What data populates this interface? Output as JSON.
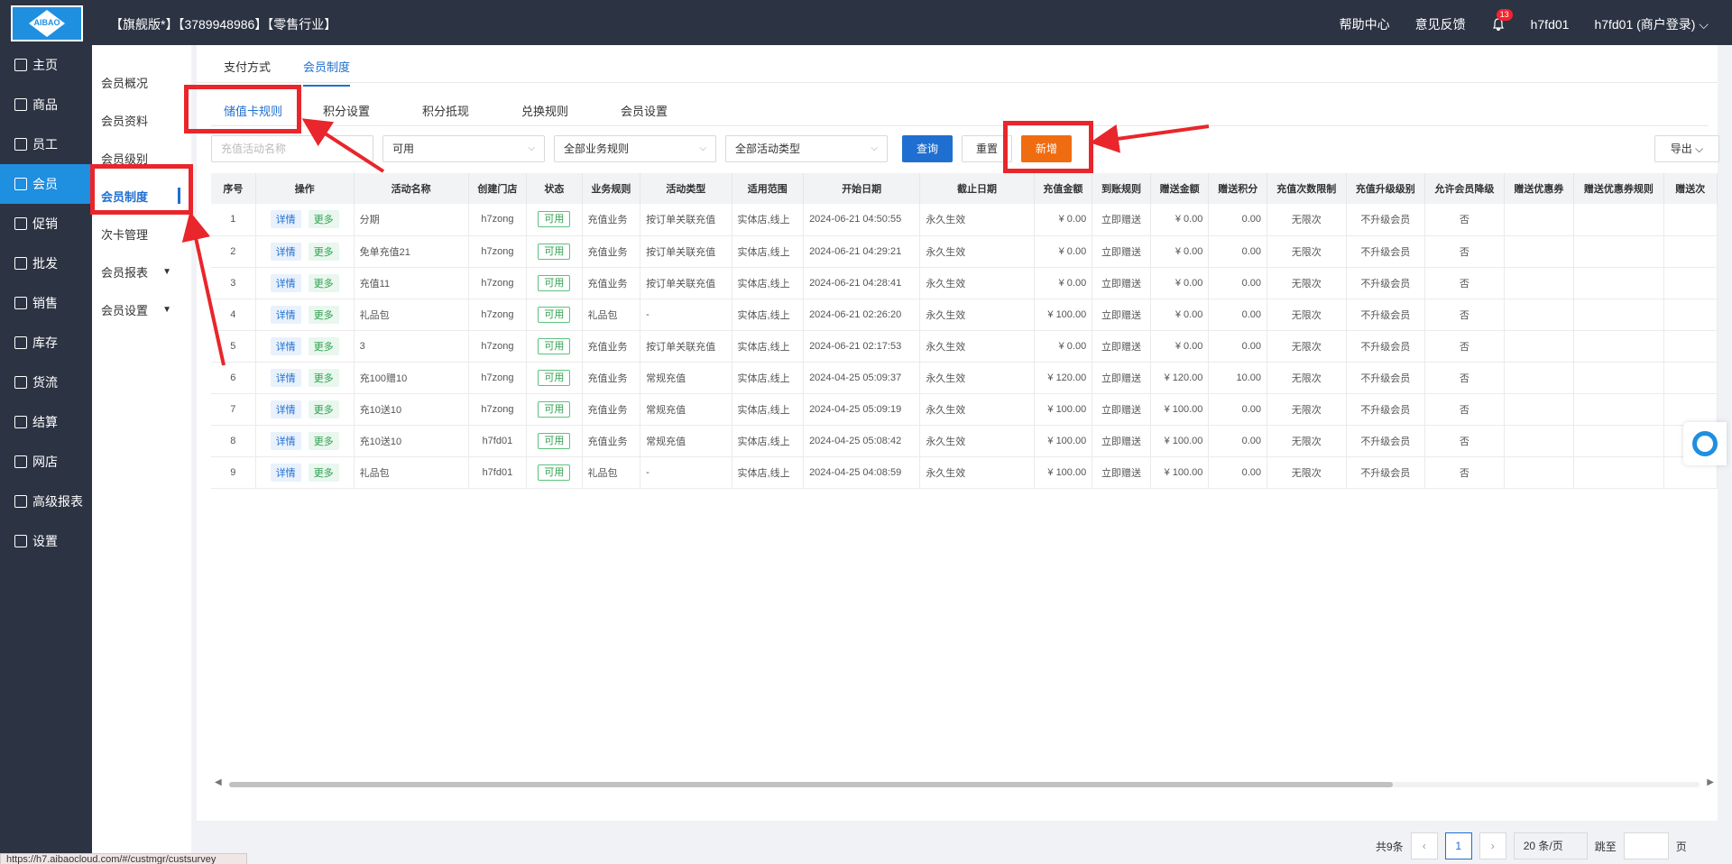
{
  "header": {
    "logo_text": "AIBAO",
    "shop_title": "【旗舰版*】【3789948986】【零售行业】",
    "help": "帮助中心",
    "feedback": "意见反馈",
    "notif_count": "13",
    "user": "h7fd01",
    "account": "h7fd01 (商户登录)"
  },
  "sidebar": {
    "items": [
      {
        "label": "主页",
        "icon": "home-icon"
      },
      {
        "label": "商品",
        "icon": "goods-icon"
      },
      {
        "label": "员工",
        "icon": "staff-icon"
      },
      {
        "label": "会员",
        "icon": "member-icon"
      },
      {
        "label": "促销",
        "icon": "promo-icon"
      },
      {
        "label": "批发",
        "icon": "wholesale-icon"
      },
      {
        "label": "销售",
        "icon": "sales-icon"
      },
      {
        "label": "库存",
        "icon": "stock-icon"
      },
      {
        "label": "货流",
        "icon": "flow-icon"
      },
      {
        "label": "结算",
        "icon": "settle-icon"
      },
      {
        "label": "网店",
        "icon": "shop-icon"
      },
      {
        "label": "高级报表",
        "icon": "report-icon"
      },
      {
        "label": "设置",
        "icon": "settings-icon"
      }
    ]
  },
  "subnav": {
    "items": [
      {
        "label": "会员概况"
      },
      {
        "label": "会员资料"
      },
      {
        "label": "会员级别"
      },
      {
        "label": "会员制度"
      },
      {
        "label": "次卡管理"
      },
      {
        "label": "会员报表"
      },
      {
        "label": "会员设置"
      }
    ]
  },
  "top_tabs": [
    "支付方式",
    "会员制度"
  ],
  "rule_tabs": [
    "储值卡规则",
    "积分设置",
    "积分抵现",
    "兑换规则",
    "会员设置"
  ],
  "filters": {
    "name_placeholder": "充值活动名称",
    "status": "可用",
    "biz_rule": "全部业务规则",
    "activity_type": "全部活动类型",
    "query": "查询",
    "reset": "重置",
    "add": "新增",
    "export": "导出"
  },
  "table": {
    "headers": [
      "序号",
      "操作",
      "活动名称",
      "创建门店",
      "状态",
      "业务规则",
      "活动类型",
      "适用范围",
      "开始日期",
      "截止日期",
      "充值金额",
      "到账规则",
      "赠送金额",
      "赠送积分",
      "充值次数限制",
      "充值升级级别",
      "允许会员降级",
      "赠送优惠券",
      "赠送优惠券规则",
      "赠送次"
    ],
    "op_detail": "详情",
    "op_more": "更多",
    "rows": [
      [
        "1",
        "分期",
        "h7zong",
        "可用",
        "充值业务",
        "按订单关联充值",
        "实体店,线上",
        "2024-06-21 04:50:55",
        "永久生效",
        "¥ 0.00",
        "立即赠送",
        "¥ 0.00",
        "0.00",
        "无限次",
        "不升级会员",
        "否"
      ],
      [
        "2",
        "免单充值21",
        "h7zong",
        "可用",
        "充值业务",
        "按订单关联充值",
        "实体店,线上",
        "2024-06-21 04:29:21",
        "永久生效",
        "¥ 0.00",
        "立即赠送",
        "¥ 0.00",
        "0.00",
        "无限次",
        "不升级会员",
        "否"
      ],
      [
        "3",
        "充值11",
        "h7zong",
        "可用",
        "充值业务",
        "按订单关联充值",
        "实体店,线上",
        "2024-06-21 04:28:41",
        "永久生效",
        "¥ 0.00",
        "立即赠送",
        "¥ 0.00",
        "0.00",
        "无限次",
        "不升级会员",
        "否"
      ],
      [
        "4",
        "礼品包",
        "h7zong",
        "可用",
        "礼品包",
        "-",
        "实体店,线上",
        "2024-06-21 02:26:20",
        "永久生效",
        "¥ 100.00",
        "立即赠送",
        "¥ 0.00",
        "0.00",
        "无限次",
        "不升级会员",
        "否"
      ],
      [
        "5",
        "3",
        "h7zong",
        "可用",
        "充值业务",
        "按订单关联充值",
        "实体店,线上",
        "2024-06-21 02:17:53",
        "永久生效",
        "¥ 0.00",
        "立即赠送",
        "¥ 0.00",
        "0.00",
        "无限次",
        "不升级会员",
        "否"
      ],
      [
        "6",
        "充100赠10",
        "h7zong",
        "可用",
        "充值业务",
        "常规充值",
        "实体店,线上",
        "2024-04-25 05:09:37",
        "永久生效",
        "¥ 120.00",
        "立即赠送",
        "¥ 120.00",
        "10.00",
        "无限次",
        "不升级会员",
        "否"
      ],
      [
        "7",
        "充10送10",
        "h7zong",
        "可用",
        "充值业务",
        "常规充值",
        "实体店,线上",
        "2024-04-25 05:09:19",
        "永久生效",
        "¥ 100.00",
        "立即赠送",
        "¥ 100.00",
        "0.00",
        "无限次",
        "不升级会员",
        "否"
      ],
      [
        "8",
        "充10送10",
        "h7fd01",
        "可用",
        "充值业务",
        "常规充值",
        "实体店,线上",
        "2024-04-25 05:08:42",
        "永久生效",
        "¥ 100.00",
        "立即赠送",
        "¥ 100.00",
        "0.00",
        "无限次",
        "不升级会员",
        "否"
      ],
      [
        "9",
        "礼品包",
        "h7fd01",
        "可用",
        "礼品包",
        "-",
        "实体店,线上",
        "2024-04-25 04:08:59",
        "永久生效",
        "¥ 100.00",
        "立即赠送",
        "¥ 100.00",
        "0.00",
        "无限次",
        "不升级会员",
        "否"
      ]
    ]
  },
  "pager": {
    "total": "共9条",
    "current": "1",
    "size": "20 条/页",
    "jump_label": "跳至",
    "page_unit": "页"
  },
  "status_url": "https://h7.aibaocloud.com/#/custmgr/custsurvey",
  "colors": {
    "accent": "#1f6fd0",
    "sidebar": "#2c3343",
    "add_button": "#f06c10",
    "annotation": "#e8262b"
  }
}
